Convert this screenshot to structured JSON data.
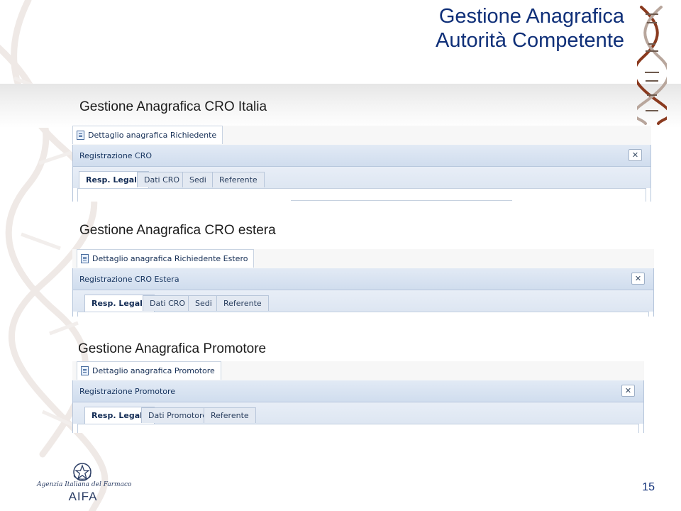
{
  "header": {
    "title_line1": "Gestione Anagrafica",
    "title_line2": "Autorità Competente",
    "title_color": "#0f2f78"
  },
  "sections": [
    {
      "heading": "Gestione Anagrafica CRO Italia",
      "main_tab": "Dettaglio anagrafica Richiedente",
      "panel_title": "Registrazione CRO",
      "tabs": [
        "Resp. Legale",
        "Dati CRO",
        "Sedi",
        "Referente"
      ],
      "active_tab": "Resp. Legale"
    },
    {
      "heading": "Gestione Anagrafica CRO estera",
      "main_tab": "Dettaglio anagrafica Richiedente Estero",
      "panel_title": "Registrazione CRO Estera",
      "tabs": [
        "Resp. Legale",
        "Dati CRO",
        "Sedi",
        "Referente"
      ],
      "active_tab": "Resp. Legale"
    },
    {
      "heading": "Gestione Anagrafica Promotore",
      "main_tab": "Dettaglio anagrafica Promotore",
      "panel_title": "Registrazione Promotore",
      "tabs": [
        "Resp. Legale",
        "Dati Promotore",
        "Referente"
      ],
      "active_tab": "Resp. Legale"
    }
  ],
  "icons": {
    "close": "close-icon",
    "document": "document-icon",
    "dna": "dna-helix-icon",
    "emblem": "italian-republic-emblem"
  },
  "footer": {
    "logo_script": "Agenzia Italiana del Farmaco",
    "logo_acronym": "AIFA",
    "page_number": "15"
  },
  "colors": {
    "panel_header": "#d6e1f0",
    "tab_strip": "#e3eaf4",
    "accent_blue": "#0f2f78"
  }
}
